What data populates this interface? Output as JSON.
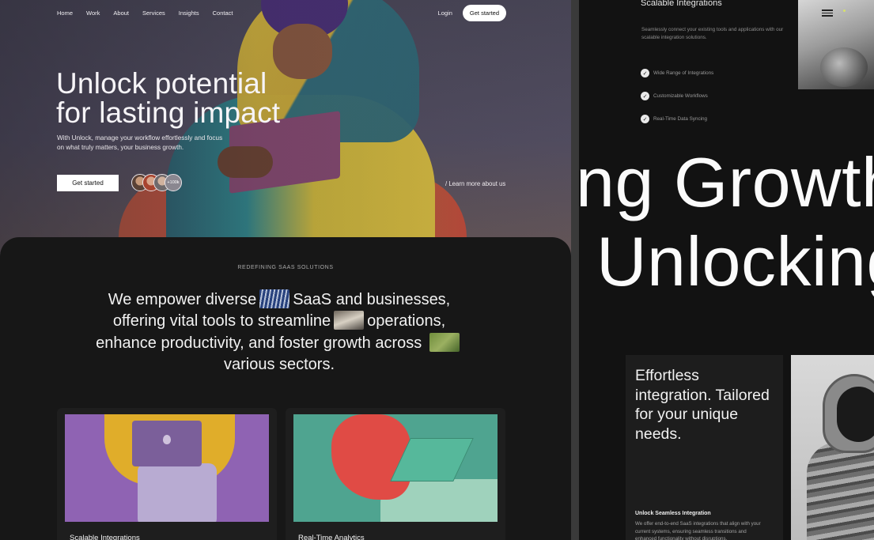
{
  "nav": {
    "links": [
      "Home",
      "Work",
      "About",
      "Services",
      "Insights",
      "Contact"
    ],
    "login": "Login",
    "cta": "Get started"
  },
  "hero": {
    "title_line1": "Unlock potential",
    "title_line2": "for lasting impact",
    "subtitle": "With Unlock, manage your workflow effortlessly and focus on what truly matters, your business growth.",
    "cta": "Get started",
    "avatar_count": "+100k",
    "learn_link": "/ Learn more about us"
  },
  "section": {
    "eyebrow": "REDEFINING SAAS SOLUTIONS",
    "statement": {
      "part1": "We empower diverse",
      "part2": "SaaS and businesses, offering vital tools to streamline",
      "part3": "operations, enhance productivity, and foster growth across",
      "part4": "various sectors."
    }
  },
  "cards": [
    {
      "title": "Scalable Integrations"
    },
    {
      "title": "Real-Time Analytics"
    }
  ],
  "right_panel": {
    "title": "Scalable Integrations",
    "description": "Seamlessly connect your existing tools and applications with our scalable integration solutions.",
    "features": [
      "Wide Range of Integrations",
      "Customizable Workflows",
      "Real-Time Data Syncing"
    ],
    "big_text_1": "ng Growth",
    "big_text_2": "Unlocking",
    "card": {
      "heading": "Effortless integration. Tailored for your unique needs.",
      "subheading": "Unlock Seamless Integration",
      "text": "We offer end-to-end SaaS integrations that align with your current systems, ensuring seamless transitions and enhanced functionality without disruptions."
    }
  },
  "colors": {
    "dark_bg": "#161616",
    "card_bg": "#1e1e1e",
    "accent_white": "#ffffff"
  }
}
